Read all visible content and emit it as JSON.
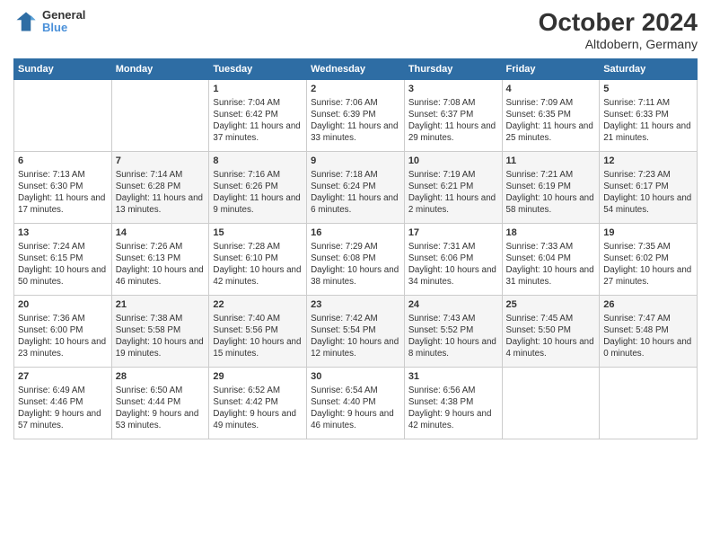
{
  "header": {
    "logo_general": "General",
    "logo_blue": "Blue",
    "month_year": "October 2024",
    "location": "Altdobern, Germany"
  },
  "days_of_week": [
    "Sunday",
    "Monday",
    "Tuesday",
    "Wednesday",
    "Thursday",
    "Friday",
    "Saturday"
  ],
  "weeks": [
    [
      {
        "day": "",
        "info": ""
      },
      {
        "day": "",
        "info": ""
      },
      {
        "day": "1",
        "info": "Sunrise: 7:04 AM\nSunset: 6:42 PM\nDaylight: 11 hours and 37 minutes."
      },
      {
        "day": "2",
        "info": "Sunrise: 7:06 AM\nSunset: 6:39 PM\nDaylight: 11 hours and 33 minutes."
      },
      {
        "day": "3",
        "info": "Sunrise: 7:08 AM\nSunset: 6:37 PM\nDaylight: 11 hours and 29 minutes."
      },
      {
        "day": "4",
        "info": "Sunrise: 7:09 AM\nSunset: 6:35 PM\nDaylight: 11 hours and 25 minutes."
      },
      {
        "day": "5",
        "info": "Sunrise: 7:11 AM\nSunset: 6:33 PM\nDaylight: 11 hours and 21 minutes."
      }
    ],
    [
      {
        "day": "6",
        "info": "Sunrise: 7:13 AM\nSunset: 6:30 PM\nDaylight: 11 hours and 17 minutes."
      },
      {
        "day": "7",
        "info": "Sunrise: 7:14 AM\nSunset: 6:28 PM\nDaylight: 11 hours and 13 minutes."
      },
      {
        "day": "8",
        "info": "Sunrise: 7:16 AM\nSunset: 6:26 PM\nDaylight: 11 hours and 9 minutes."
      },
      {
        "day": "9",
        "info": "Sunrise: 7:18 AM\nSunset: 6:24 PM\nDaylight: 11 hours and 6 minutes."
      },
      {
        "day": "10",
        "info": "Sunrise: 7:19 AM\nSunset: 6:21 PM\nDaylight: 11 hours and 2 minutes."
      },
      {
        "day": "11",
        "info": "Sunrise: 7:21 AM\nSunset: 6:19 PM\nDaylight: 10 hours and 58 minutes."
      },
      {
        "day": "12",
        "info": "Sunrise: 7:23 AM\nSunset: 6:17 PM\nDaylight: 10 hours and 54 minutes."
      }
    ],
    [
      {
        "day": "13",
        "info": "Sunrise: 7:24 AM\nSunset: 6:15 PM\nDaylight: 10 hours and 50 minutes."
      },
      {
        "day": "14",
        "info": "Sunrise: 7:26 AM\nSunset: 6:13 PM\nDaylight: 10 hours and 46 minutes."
      },
      {
        "day": "15",
        "info": "Sunrise: 7:28 AM\nSunset: 6:10 PM\nDaylight: 10 hours and 42 minutes."
      },
      {
        "day": "16",
        "info": "Sunrise: 7:29 AM\nSunset: 6:08 PM\nDaylight: 10 hours and 38 minutes."
      },
      {
        "day": "17",
        "info": "Sunrise: 7:31 AM\nSunset: 6:06 PM\nDaylight: 10 hours and 34 minutes."
      },
      {
        "day": "18",
        "info": "Sunrise: 7:33 AM\nSunset: 6:04 PM\nDaylight: 10 hours and 31 minutes."
      },
      {
        "day": "19",
        "info": "Sunrise: 7:35 AM\nSunset: 6:02 PM\nDaylight: 10 hours and 27 minutes."
      }
    ],
    [
      {
        "day": "20",
        "info": "Sunrise: 7:36 AM\nSunset: 6:00 PM\nDaylight: 10 hours and 23 minutes."
      },
      {
        "day": "21",
        "info": "Sunrise: 7:38 AM\nSunset: 5:58 PM\nDaylight: 10 hours and 19 minutes."
      },
      {
        "day": "22",
        "info": "Sunrise: 7:40 AM\nSunset: 5:56 PM\nDaylight: 10 hours and 15 minutes."
      },
      {
        "day": "23",
        "info": "Sunrise: 7:42 AM\nSunset: 5:54 PM\nDaylight: 10 hours and 12 minutes."
      },
      {
        "day": "24",
        "info": "Sunrise: 7:43 AM\nSunset: 5:52 PM\nDaylight: 10 hours and 8 minutes."
      },
      {
        "day": "25",
        "info": "Sunrise: 7:45 AM\nSunset: 5:50 PM\nDaylight: 10 hours and 4 minutes."
      },
      {
        "day": "26",
        "info": "Sunrise: 7:47 AM\nSunset: 5:48 PM\nDaylight: 10 hours and 0 minutes."
      }
    ],
    [
      {
        "day": "27",
        "info": "Sunrise: 6:49 AM\nSunset: 4:46 PM\nDaylight: 9 hours and 57 minutes."
      },
      {
        "day": "28",
        "info": "Sunrise: 6:50 AM\nSunset: 4:44 PM\nDaylight: 9 hours and 53 minutes."
      },
      {
        "day": "29",
        "info": "Sunrise: 6:52 AM\nSunset: 4:42 PM\nDaylight: 9 hours and 49 minutes."
      },
      {
        "day": "30",
        "info": "Sunrise: 6:54 AM\nSunset: 4:40 PM\nDaylight: 9 hours and 46 minutes."
      },
      {
        "day": "31",
        "info": "Sunrise: 6:56 AM\nSunset: 4:38 PM\nDaylight: 9 hours and 42 minutes."
      },
      {
        "day": "",
        "info": ""
      },
      {
        "day": "",
        "info": ""
      }
    ]
  ]
}
